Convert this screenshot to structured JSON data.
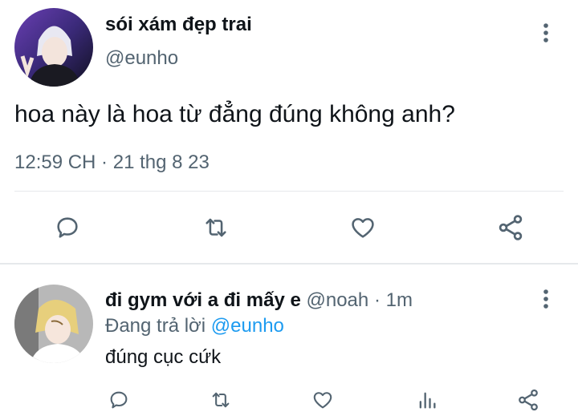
{
  "main_tweet": {
    "display_name": "sói xám đẹp trai",
    "handle": "@eunho",
    "text": "hoa này là hoa từ đẳng đúng không anh?",
    "timestamp": "12:59 CH · 21 thg 8 23",
    "actions": [
      "reply-icon",
      "retweet-icon",
      "like-icon",
      "share-icon"
    ],
    "menu_icon": "more-vertical-icon"
  },
  "reply_tweet": {
    "display_name": "đi gym với a đi mấy e",
    "handle": "@noah",
    "time": "· 1m",
    "replying_prefix": "Đang trả lời",
    "replying_to": "@eunho",
    "text": "đúng cục cứk",
    "actions": [
      "reply-icon",
      "retweet-icon",
      "like-icon",
      "views-icon",
      "share-icon"
    ],
    "menu_icon": "more-vertical-icon"
  },
  "colors": {
    "text": "#0f1419",
    "secondary": "#536471",
    "accent": "#1d9bf0",
    "divider": "#e6e9eb"
  }
}
